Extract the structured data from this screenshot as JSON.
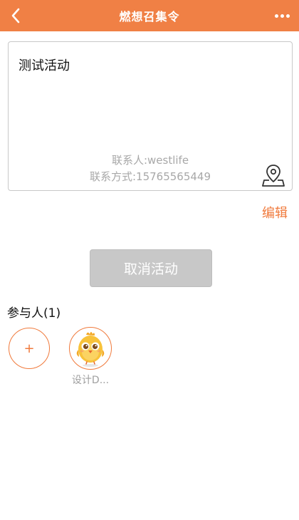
{
  "header": {
    "title": "燃想召集令"
  },
  "activity": {
    "name": "测试活动",
    "contact_person": "联系人:westlife",
    "contact_phone": "联系方式:15765565449"
  },
  "actions": {
    "edit_label": "编辑",
    "cancel_label": "取消活动"
  },
  "participants": {
    "title": "参与人(1)",
    "add_label": "+",
    "list": [
      {
        "name": "设计D..."
      }
    ]
  },
  "colors": {
    "accent": "#f08045",
    "edit_text": "#f07a3c",
    "disabled_button": "#c8c8c8",
    "muted_text": "#a8a8a8"
  },
  "icons": {
    "back": "chevron-left-icon",
    "more": "more-dots-icon",
    "location": "map-pin-icon",
    "avatar": "chick-avatar"
  }
}
